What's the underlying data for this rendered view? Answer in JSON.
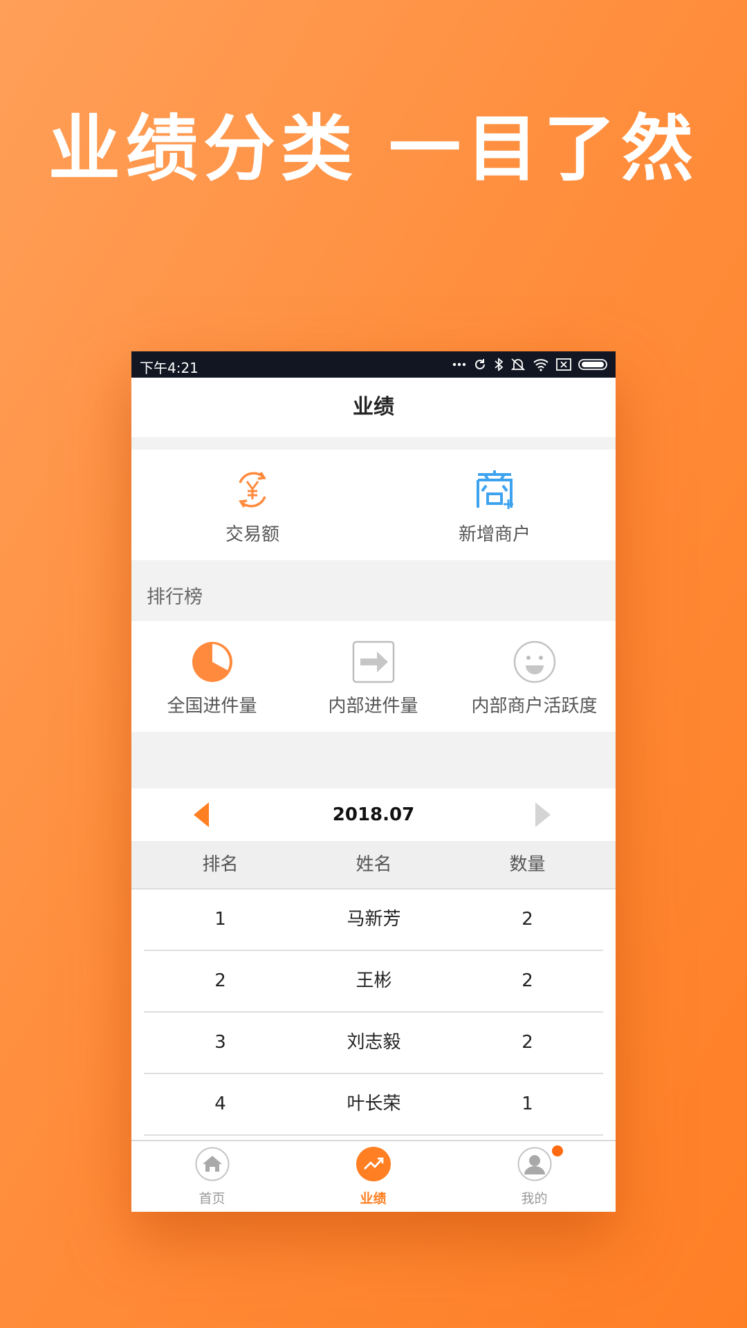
{
  "headline": "业绩分类 一目了然",
  "status_bar": {
    "time": "下午4:21"
  },
  "page_title": "业绩",
  "quick_cards": [
    {
      "label": "交易额",
      "icon": "yuan-refresh-icon",
      "color": "#ff8a3d"
    },
    {
      "label": "新增商户",
      "icon": "merchant-add-icon",
      "color": "#3ea3ef"
    }
  ],
  "ranking": {
    "section_label": "排行榜",
    "items": [
      {
        "label": "全国进件量",
        "icon": "pie-chart-icon"
      },
      {
        "label": "内部进件量",
        "icon": "arrow-right-box-icon"
      },
      {
        "label": "内部商户活跃度",
        "icon": "smiley-icon"
      }
    ]
  },
  "month_nav": {
    "month": "2018.07"
  },
  "table": {
    "headers": [
      "排名",
      "姓名",
      "数量"
    ],
    "rows": [
      [
        "1",
        "马新芳",
        "2"
      ],
      [
        "2",
        "王彬",
        "2"
      ],
      [
        "3",
        "刘志毅",
        "2"
      ],
      [
        "4",
        "叶长荣",
        "1"
      ]
    ]
  },
  "tabs": [
    {
      "label": "首页",
      "icon": "home-icon",
      "active": false
    },
    {
      "label": "业绩",
      "icon": "trend-up-icon",
      "active": true
    },
    {
      "label": "我的",
      "icon": "user-icon",
      "active": false
    }
  ],
  "colors": {
    "accent": "#ff7f22",
    "blue": "#3ea3ef",
    "status_bar": "#121622"
  }
}
